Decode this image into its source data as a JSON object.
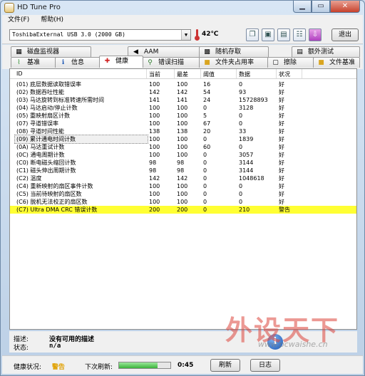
{
  "window": {
    "title": "HD Tune Pro"
  },
  "menu": [
    "文件(F)",
    "帮助(H)"
  ],
  "toolbar": {
    "drive": "ToshibaExternal USB 3.0 (2000 GB)",
    "temperature": "42℃",
    "exit_label": "退出",
    "icons": [
      "copy-info-icon",
      "copy-screenshot-icon",
      "save-icon",
      "options-icon",
      "download-icon"
    ]
  },
  "tabs": {
    "row1": [
      {
        "label": "磁盘监视器",
        "icon": "monitor-icon"
      },
      {
        "label": "AAM",
        "icon": "speaker-icon"
      },
      {
        "label": "随机存取",
        "icon": "random-access-icon"
      },
      {
        "label": "额外测试",
        "icon": "extra-tests-icon"
      }
    ],
    "row2": [
      {
        "label": "基准",
        "icon": "benchmark-icon"
      },
      {
        "label": "信息",
        "icon": "info-icon"
      },
      {
        "label": "健康",
        "icon": "health-cross-icon"
      },
      {
        "label": "错误扫描",
        "icon": "magnifier-icon"
      },
      {
        "label": "文件夹占用率",
        "icon": "folder-icon"
      },
      {
        "label": "擦除",
        "icon": "erase-icon"
      },
      {
        "label": "文件基准",
        "icon": "file-benchmark-icon"
      }
    ]
  },
  "table": {
    "headers": {
      "id": "ID",
      "current": "当前",
      "worst": "最差",
      "threshold": "阈值",
      "data": "数据",
      "status": "状况"
    },
    "rows": [
      {
        "id": "(01) 底层数据读取错误率",
        "current": "100",
        "worst": "100",
        "threshold": "16",
        "data": "0",
        "status": "好"
      },
      {
        "id": "(02) 数据吞吐性能",
        "current": "142",
        "worst": "142",
        "threshold": "54",
        "data": "93",
        "status": "好"
      },
      {
        "id": "(03) 马达旋转到标准转速所需时间",
        "current": "141",
        "worst": "141",
        "threshold": "24",
        "data": "15728893",
        "status": "好"
      },
      {
        "id": "(04) 马达启动/停止计数",
        "current": "100",
        "worst": "100",
        "threshold": "0",
        "data": "3128",
        "status": "好"
      },
      {
        "id": "(05) 重映射扇区计数",
        "current": "100",
        "worst": "100",
        "threshold": "5",
        "data": "0",
        "status": "好"
      },
      {
        "id": "(07) 寻道错误率",
        "current": "100",
        "worst": "100",
        "threshold": "67",
        "data": "0",
        "status": "好"
      },
      {
        "id": "(08) 寻道时间性能",
        "current": "138",
        "worst": "138",
        "threshold": "20",
        "data": "33",
        "status": "好"
      },
      {
        "id": "(09) 累计通电时间计数",
        "current": "100",
        "worst": "100",
        "threshold": "0",
        "data": "1839",
        "status": "好"
      },
      {
        "id": "(0A) 马达重试计数",
        "current": "100",
        "worst": "100",
        "threshold": "60",
        "data": "0",
        "status": "好"
      },
      {
        "id": "(0C) 通电周期计数",
        "current": "100",
        "worst": "100",
        "threshold": "0",
        "data": "3057",
        "status": "好"
      },
      {
        "id": "(C0) 断电磁头缩回计数",
        "current": "98",
        "worst": "98",
        "threshold": "0",
        "data": "3144",
        "status": "好"
      },
      {
        "id": "(C1) 磁头伸出周期计数",
        "current": "98",
        "worst": "98",
        "threshold": "0",
        "data": "3144",
        "status": "好"
      },
      {
        "id": "(C2) 温度",
        "current": "142",
        "worst": "142",
        "threshold": "0",
        "data": "1048618",
        "status": "好"
      },
      {
        "id": "(C4) 重新映射的扇区事件计数",
        "current": "100",
        "worst": "100",
        "threshold": "0",
        "data": "0",
        "status": "好"
      },
      {
        "id": "(C5) 当前待映射的扇区数",
        "current": "100",
        "worst": "100",
        "threshold": "0",
        "data": "0",
        "status": "好"
      },
      {
        "id": "(C6) 脱机无法校正的扇区数",
        "current": "100",
        "worst": "100",
        "threshold": "0",
        "data": "0",
        "status": "好"
      },
      {
        "id": "(C7) Ultra DMA CRC 错误计数",
        "current": "200",
        "worst": "200",
        "threshold": "0",
        "data": "210",
        "status": "警告"
      }
    ]
  },
  "info": {
    "description_label": "描述:",
    "description_value": "没有可用的描述",
    "status_label": "状态:",
    "status_value": "n/a"
  },
  "statusbar": {
    "health_label": "健康状况:",
    "health_value": "警告",
    "refresh_label": "下次刷新:",
    "countdown": "0:45",
    "progress_fraction": 0.75,
    "refresh_button": "刷新",
    "log_button": "日志"
  },
  "watermark": {
    "text": "外设天下",
    "url": "www.pcwaishe.cn"
  },
  "colors": {
    "warning_row": "#ffff33",
    "health_warning_text": "#e0a000"
  }
}
